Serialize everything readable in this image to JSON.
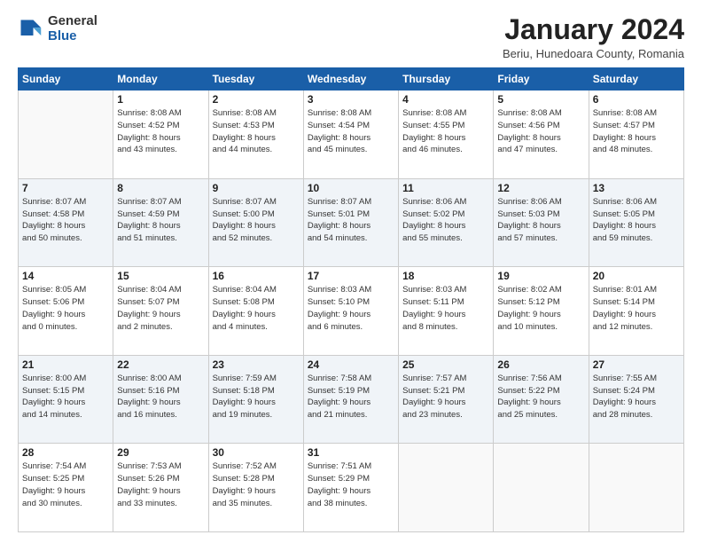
{
  "header": {
    "logo_general": "General",
    "logo_blue": "Blue",
    "title": "January 2024",
    "subtitle": "Beriu, Hunedoara County, Romania"
  },
  "days_of_week": [
    "Sunday",
    "Monday",
    "Tuesday",
    "Wednesday",
    "Thursday",
    "Friday",
    "Saturday"
  ],
  "weeks": [
    [
      {
        "day": "",
        "info": ""
      },
      {
        "day": "1",
        "info": "Sunrise: 8:08 AM\nSunset: 4:52 PM\nDaylight: 8 hours\nand 43 minutes."
      },
      {
        "day": "2",
        "info": "Sunrise: 8:08 AM\nSunset: 4:53 PM\nDaylight: 8 hours\nand 44 minutes."
      },
      {
        "day": "3",
        "info": "Sunrise: 8:08 AM\nSunset: 4:54 PM\nDaylight: 8 hours\nand 45 minutes."
      },
      {
        "day": "4",
        "info": "Sunrise: 8:08 AM\nSunset: 4:55 PM\nDaylight: 8 hours\nand 46 minutes."
      },
      {
        "day": "5",
        "info": "Sunrise: 8:08 AM\nSunset: 4:56 PM\nDaylight: 8 hours\nand 47 minutes."
      },
      {
        "day": "6",
        "info": "Sunrise: 8:08 AM\nSunset: 4:57 PM\nDaylight: 8 hours\nand 48 minutes."
      }
    ],
    [
      {
        "day": "7",
        "info": "Sunrise: 8:07 AM\nSunset: 4:58 PM\nDaylight: 8 hours\nand 50 minutes."
      },
      {
        "day": "8",
        "info": "Sunrise: 8:07 AM\nSunset: 4:59 PM\nDaylight: 8 hours\nand 51 minutes."
      },
      {
        "day": "9",
        "info": "Sunrise: 8:07 AM\nSunset: 5:00 PM\nDaylight: 8 hours\nand 52 minutes."
      },
      {
        "day": "10",
        "info": "Sunrise: 8:07 AM\nSunset: 5:01 PM\nDaylight: 8 hours\nand 54 minutes."
      },
      {
        "day": "11",
        "info": "Sunrise: 8:06 AM\nSunset: 5:02 PM\nDaylight: 8 hours\nand 55 minutes."
      },
      {
        "day": "12",
        "info": "Sunrise: 8:06 AM\nSunset: 5:03 PM\nDaylight: 8 hours\nand 57 minutes."
      },
      {
        "day": "13",
        "info": "Sunrise: 8:06 AM\nSunset: 5:05 PM\nDaylight: 8 hours\nand 59 minutes."
      }
    ],
    [
      {
        "day": "14",
        "info": "Sunrise: 8:05 AM\nSunset: 5:06 PM\nDaylight: 9 hours\nand 0 minutes."
      },
      {
        "day": "15",
        "info": "Sunrise: 8:04 AM\nSunset: 5:07 PM\nDaylight: 9 hours\nand 2 minutes."
      },
      {
        "day": "16",
        "info": "Sunrise: 8:04 AM\nSunset: 5:08 PM\nDaylight: 9 hours\nand 4 minutes."
      },
      {
        "day": "17",
        "info": "Sunrise: 8:03 AM\nSunset: 5:10 PM\nDaylight: 9 hours\nand 6 minutes."
      },
      {
        "day": "18",
        "info": "Sunrise: 8:03 AM\nSunset: 5:11 PM\nDaylight: 9 hours\nand 8 minutes."
      },
      {
        "day": "19",
        "info": "Sunrise: 8:02 AM\nSunset: 5:12 PM\nDaylight: 9 hours\nand 10 minutes."
      },
      {
        "day": "20",
        "info": "Sunrise: 8:01 AM\nSunset: 5:14 PM\nDaylight: 9 hours\nand 12 minutes."
      }
    ],
    [
      {
        "day": "21",
        "info": "Sunrise: 8:00 AM\nSunset: 5:15 PM\nDaylight: 9 hours\nand 14 minutes."
      },
      {
        "day": "22",
        "info": "Sunrise: 8:00 AM\nSunset: 5:16 PM\nDaylight: 9 hours\nand 16 minutes."
      },
      {
        "day": "23",
        "info": "Sunrise: 7:59 AM\nSunset: 5:18 PM\nDaylight: 9 hours\nand 19 minutes."
      },
      {
        "day": "24",
        "info": "Sunrise: 7:58 AM\nSunset: 5:19 PM\nDaylight: 9 hours\nand 21 minutes."
      },
      {
        "day": "25",
        "info": "Sunrise: 7:57 AM\nSunset: 5:21 PM\nDaylight: 9 hours\nand 23 minutes."
      },
      {
        "day": "26",
        "info": "Sunrise: 7:56 AM\nSunset: 5:22 PM\nDaylight: 9 hours\nand 25 minutes."
      },
      {
        "day": "27",
        "info": "Sunrise: 7:55 AM\nSunset: 5:24 PM\nDaylight: 9 hours\nand 28 minutes."
      }
    ],
    [
      {
        "day": "28",
        "info": "Sunrise: 7:54 AM\nSunset: 5:25 PM\nDaylight: 9 hours\nand 30 minutes."
      },
      {
        "day": "29",
        "info": "Sunrise: 7:53 AM\nSunset: 5:26 PM\nDaylight: 9 hours\nand 33 minutes."
      },
      {
        "day": "30",
        "info": "Sunrise: 7:52 AM\nSunset: 5:28 PM\nDaylight: 9 hours\nand 35 minutes."
      },
      {
        "day": "31",
        "info": "Sunrise: 7:51 AM\nSunset: 5:29 PM\nDaylight: 9 hours\nand 38 minutes."
      },
      {
        "day": "",
        "info": ""
      },
      {
        "day": "",
        "info": ""
      },
      {
        "day": "",
        "info": ""
      }
    ]
  ]
}
